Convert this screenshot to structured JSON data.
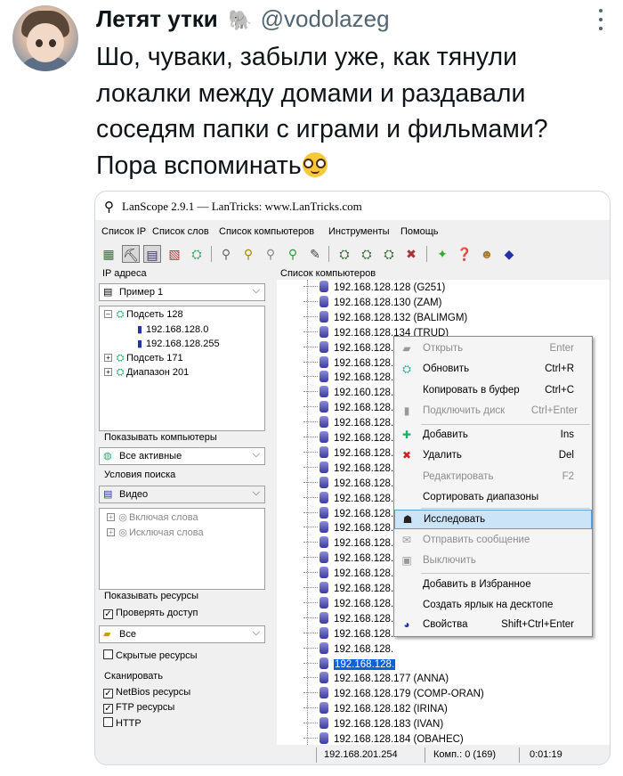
{
  "tweet": {
    "name": "Летят утки",
    "handle": "@vodolazeg",
    "lines": [
      "Шо, чуваки, забыли уже, как тянули",
      "локалки между домами и раздавали",
      "соседям папки с играми и фильмами?",
      "Пора вспоминать"
    ]
  },
  "app": {
    "title": "LanScope 2.9.1 — LanTricks: www.LanTricks.com",
    "menu": [
      "Список IP",
      "Список слов",
      "Список компьютеров",
      "Инструменты",
      "Помощь"
    ],
    "left": {
      "ip_label": "IP адреса",
      "ip_combo": "Пример 1",
      "ip_tree": [
        {
          "label": "Подсеть 128",
          "exp": "–"
        },
        {
          "label": "192.168.128.0"
        },
        {
          "label": "192.168.128.255"
        },
        {
          "label": "Подсеть 171",
          "exp": "+"
        },
        {
          "label": "Диапазон 201",
          "exp": "+"
        }
      ],
      "show_label": "Показывать компьютеры",
      "show_combo": "Все активные",
      "search_label": "Условия поиска",
      "search_combo": "Видео",
      "search_tree": [
        "Включая слова",
        "Исключая слова"
      ],
      "res_label": "Показывать ресурсы",
      "check_access": "Проверять доступ",
      "res_combo": "Все",
      "hidden": "Скрытые ресурсы",
      "scan_label": "Сканировать",
      "scan": [
        "NetBios ресурсы",
        "FTP ресурсы",
        "HTTP"
      ],
      "scan_checked": [
        true,
        true,
        false
      ]
    },
    "list_label": "Список компьютеров",
    "list": [
      "192.168.128.128 (G251)",
      "192.168.128.130 (ZAM)",
      "192.168.128.132 (BALIMGM)",
      "192.168.128.134 (TRUD)",
      "192.168.128.",
      "192.168.128.",
      "192.168.128.",
      "192.160.128.",
      "192.168.128.",
      "192.168.128.",
      "192.168.128.",
      "192.168.128.",
      "192.168.128.",
      "192.168.128.",
      "192.168.128.",
      "192.168.128.",
      "192.168.128.",
      "192.168.128.",
      "192.168.128.",
      "192.168.128.",
      "192.168.128.",
      "192.168.128.",
      "192.168.128.",
      "192.168.128.",
      "192.168.128.",
      "192.168.128.",
      "192.168.128.177 (ANNA)",
      "192.168.128.179 (COMP-ORAN)",
      "192.168.128.182 (IRINA)",
      "192.168.128.183 (IVAN)",
      "192.168.128.184 (OBAHEC)",
      "192.168.128.185 (MRCPK2)",
      "192.168.128.186 (ZAVKAFEDRY)"
    ],
    "status": {
      "ip": "192.168.201.254",
      "comp": "Комп.: 0 (169)",
      "time": "0:01:19"
    },
    "context_menu": [
      {
        "label": "Открыть",
        "shortcut": "Enter",
        "dis": true
      },
      {
        "label": "Обновить",
        "shortcut": "Ctrl+R"
      },
      {
        "label": "Копировать в буфер",
        "shortcut": "Ctrl+C"
      },
      {
        "label": "Подключить диск",
        "shortcut": "Ctrl+Enter",
        "dis": true
      },
      {
        "label": "Добавить",
        "shortcut": "Ins"
      },
      {
        "label": "Удалить",
        "shortcut": "Del"
      },
      {
        "label": "Редактировать",
        "shortcut": "F2",
        "dis": true
      },
      {
        "label": "Сортировать диапазоны",
        "shortcut": ""
      },
      {
        "label": "Исследовать",
        "shortcut": ""
      },
      {
        "label": "Отправить сообщение",
        "shortcut": "",
        "dis": true
      },
      {
        "label": "Выключить",
        "shortcut": "",
        "dis": true
      },
      {
        "label": "Добавить в Избранное",
        "shortcut": ""
      },
      {
        "label": "Создать ярлык на десктопе",
        "shortcut": ""
      },
      {
        "label": "Свойства",
        "shortcut": "Shift+Ctrl+Enter"
      }
    ]
  }
}
